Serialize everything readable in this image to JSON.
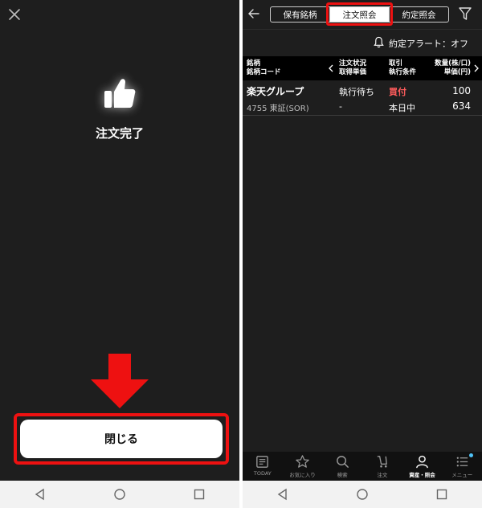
{
  "left": {
    "completion_text": "注文完了",
    "close_button_label": "閉じる",
    "icons": {
      "close": "close-icon",
      "thumb": "thumbs-up-icon",
      "arrow": "down-arrow-icon"
    }
  },
  "right": {
    "tabs": [
      {
        "label": "保有銘柄",
        "active": false
      },
      {
        "label": "注文照会",
        "active": true
      },
      {
        "label": "約定照会",
        "active": false
      }
    ],
    "alert_text": "約定アラート：オフ",
    "table_headers": {
      "col1_line1": "銘柄",
      "col1_line2": "銘柄コード",
      "col2_line1": "注文状況",
      "col2_line2": "取得単価",
      "col3_line1": "取引",
      "col3_line2": "執行条件",
      "col4_line1": "数量(株/口)",
      "col4_line2": "単価(円)"
    },
    "orders": [
      {
        "name": "楽天グループ",
        "code_market": "4755 東証(SOR)",
        "status": "執行待ち",
        "unit_price": "-",
        "trade": "買付",
        "condition": "本日中",
        "quantity": "100",
        "price": "634"
      }
    ],
    "bottom_nav": [
      {
        "label": "TODAY",
        "icon": "newspaper-icon",
        "active": false
      },
      {
        "label": "お気に入り",
        "icon": "star-icon",
        "active": false
      },
      {
        "label": "検索",
        "icon": "search-icon",
        "active": false
      },
      {
        "label": "注文",
        "icon": "cart-icon",
        "active": false
      },
      {
        "label": "資産・照会",
        "icon": "person-icon",
        "active": true
      },
      {
        "label": "メニュー",
        "icon": "menu-icon",
        "active": false
      }
    ]
  },
  "colors": {
    "background": "#1e1e1e",
    "highlight_red": "#ee1111",
    "buy_red": "#ff5c5c",
    "badge_blue": "#4fc3f7"
  }
}
